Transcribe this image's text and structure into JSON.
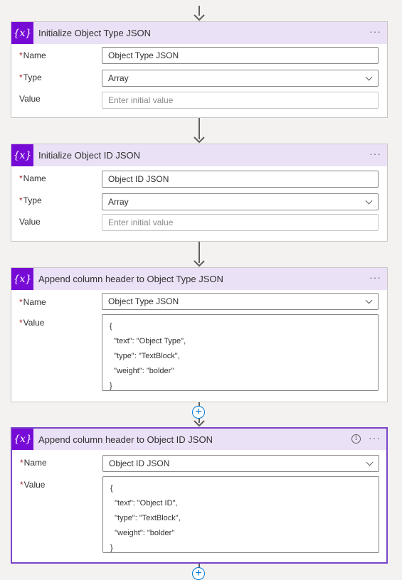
{
  "cards": [
    {
      "title": "Initialize Object Type JSON",
      "name_label": "Name",
      "name_value": "Object Type JSON",
      "type_label": "Type",
      "type_value": "Array",
      "value_label": "Value",
      "value_placeholder": "Enter initial value"
    },
    {
      "title": "Initialize Object ID JSON",
      "name_label": "Name",
      "name_value": "Object ID JSON",
      "type_label": "Type",
      "type_value": "Array",
      "value_label": "Value",
      "value_placeholder": "Enter initial value"
    },
    {
      "title": "Append column header to Object Type JSON",
      "name_label": "Name",
      "name_value": "Object Type JSON",
      "value_label": "Value",
      "value_lines": [
        "{",
        "  \"text\": \"Object Type\",",
        "  \"type\": \"TextBlock\",",
        "  \"weight\": \"bolder\"",
        "}"
      ]
    },
    {
      "title": "Append column header to Object ID JSON",
      "name_label": "Name",
      "name_value": "Object ID JSON",
      "value_label": "Value",
      "value_lines": [
        "{",
        "  \"text\": \"Object ID\",",
        "  \"type\": \"TextBlock\",",
        "  \"weight\": \"bolder\"",
        "}"
      ]
    }
  ],
  "icons": {
    "variable": "{x}",
    "more": "···",
    "info": "i",
    "add": "+"
  },
  "required_marker": "*",
  "colors": {
    "header_bg": "#ebe1f6",
    "icon_bg": "#770bd6",
    "selected_border": "#7a45c9",
    "required": "#a4262c",
    "add_button": "#0078d4"
  }
}
